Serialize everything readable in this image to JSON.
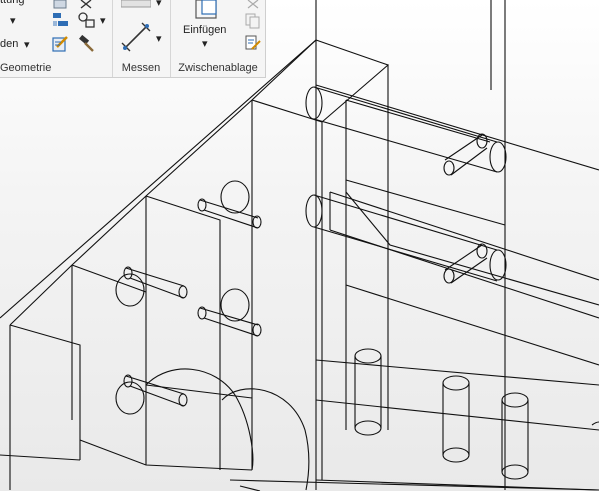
{
  "ribbon": {
    "geometrie": {
      "title": "Geometrie",
      "row1_label": "ttung",
      "row3_label": "den",
      "dropdown_glyph": "▾"
    },
    "messen": {
      "title": "Messen"
    },
    "zwischenablage": {
      "title": "Zwischenablage",
      "einfuegen_label": "Einfügen"
    }
  },
  "viewport": {
    "line_color": "#111111",
    "style": "wireframe"
  }
}
